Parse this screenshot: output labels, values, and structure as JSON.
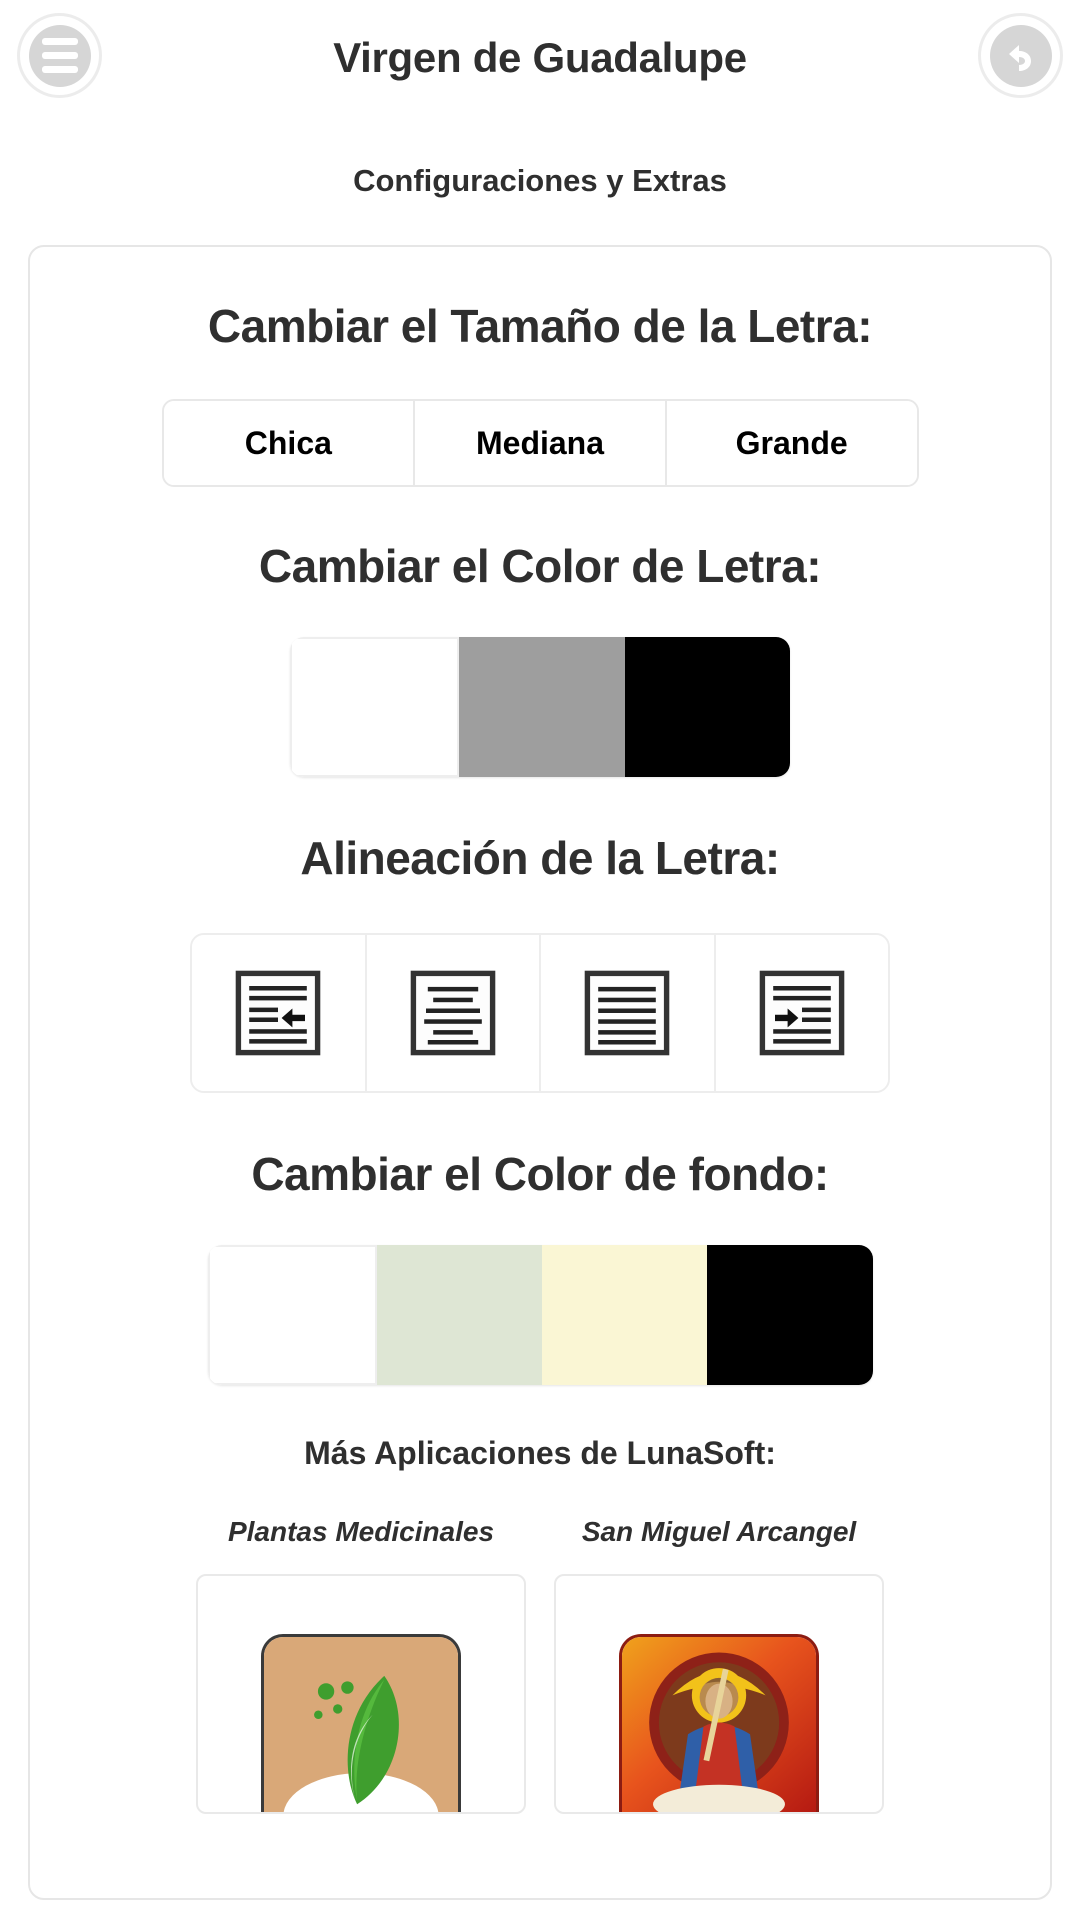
{
  "header": {
    "title": "Virgen de Guadalupe",
    "subtitle": "Configuraciones y Extras",
    "menu_icon": "hamburger-menu-icon",
    "back_icon": "back-arrow-icon"
  },
  "font_size": {
    "title": "Cambiar el Tamaño de la Letra:",
    "options": [
      {
        "label": "Chica"
      },
      {
        "label": "Mediana"
      },
      {
        "label": "Grande"
      }
    ]
  },
  "text_color": {
    "title": "Cambiar el Color de Letra:",
    "swatches": [
      {
        "name": "white",
        "hex": "#ffffff"
      },
      {
        "name": "gray",
        "hex": "#9e9e9e"
      },
      {
        "name": "black",
        "hex": "#000000"
      }
    ]
  },
  "alignment": {
    "title": "Alineación de la Letra:",
    "options": [
      {
        "icon": "align-outdent-left-icon"
      },
      {
        "icon": "align-center-icon"
      },
      {
        "icon": "align-justify-icon"
      },
      {
        "icon": "align-indent-right-icon"
      }
    ]
  },
  "background_color": {
    "title": "Cambiar el Color de fondo:",
    "swatches": [
      {
        "name": "white",
        "hex": "#ffffff"
      },
      {
        "name": "pale-green",
        "hex": "#dee6d4"
      },
      {
        "name": "cream",
        "hex": "#faf6d4"
      },
      {
        "name": "black",
        "hex": "#000000"
      }
    ]
  },
  "more_apps": {
    "title": "Más Aplicaciones de LunaSoft:",
    "apps": [
      {
        "label": "Plantas Medicinales",
        "icon": "plantas-medicinales-app-icon"
      },
      {
        "label": "San Miguel Arcangel",
        "icon": "san-miguel-arcangel-app-icon"
      }
    ]
  },
  "colors": {
    "text_dark": "#2f2f2f",
    "border_light": "#e8e8e8"
  }
}
